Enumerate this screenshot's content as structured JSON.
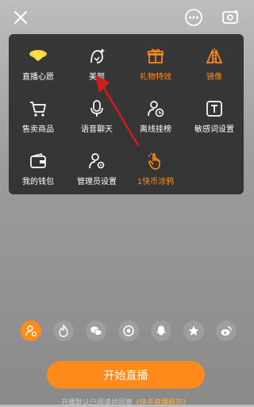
{
  "topbar": {
    "close_icon": "close-icon",
    "more_icon": "more-icon",
    "camera_switch_icon": "camera-switch-icon"
  },
  "panel": {
    "items": [
      {
        "label": "直播心愿",
        "icon": "heart-icon",
        "color": "#ffffff"
      },
      {
        "label": "美颜",
        "icon": "beauty-icon",
        "color": "#ffffff"
      },
      {
        "label": "礼物特效",
        "icon": "gift-icon",
        "color": "#ff8c1a"
      },
      {
        "label": "镜像",
        "icon": "mirror-icon",
        "color": "#ff8c1a"
      },
      {
        "label": "售卖商品",
        "icon": "cart-icon",
        "color": "#ffffff"
      },
      {
        "label": "语音聊天",
        "icon": "microphone-icon",
        "color": "#ffffff"
      },
      {
        "label": "离线挂榜",
        "icon": "user-clock-icon",
        "color": "#ffffff"
      },
      {
        "label": "敏感词设置",
        "icon": "text-icon",
        "color": "#ffffff"
      },
      {
        "label": "我的钱包",
        "icon": "wallet-icon",
        "color": "#ffffff"
      },
      {
        "label": "管理员设置",
        "icon": "admin-icon",
        "color": "#ffffff"
      },
      {
        "label": "1快币涂鸦",
        "icon": "hand-pointer-icon",
        "color": "#ff8c1a"
      }
    ]
  },
  "share": {
    "items": [
      "user-share-icon",
      "fire-icon",
      "wechat-icon",
      "moments-icon",
      "qq-icon",
      "star-icon",
      "weibo-icon"
    ]
  },
  "footer": {
    "start_label": "开始直播",
    "agree_text": "开播默认已阅读并同意",
    "agree_link": "《快手直播规范》"
  },
  "colors": {
    "accent": "#ff8c1a",
    "panel_bg": "#2d2d2d"
  }
}
